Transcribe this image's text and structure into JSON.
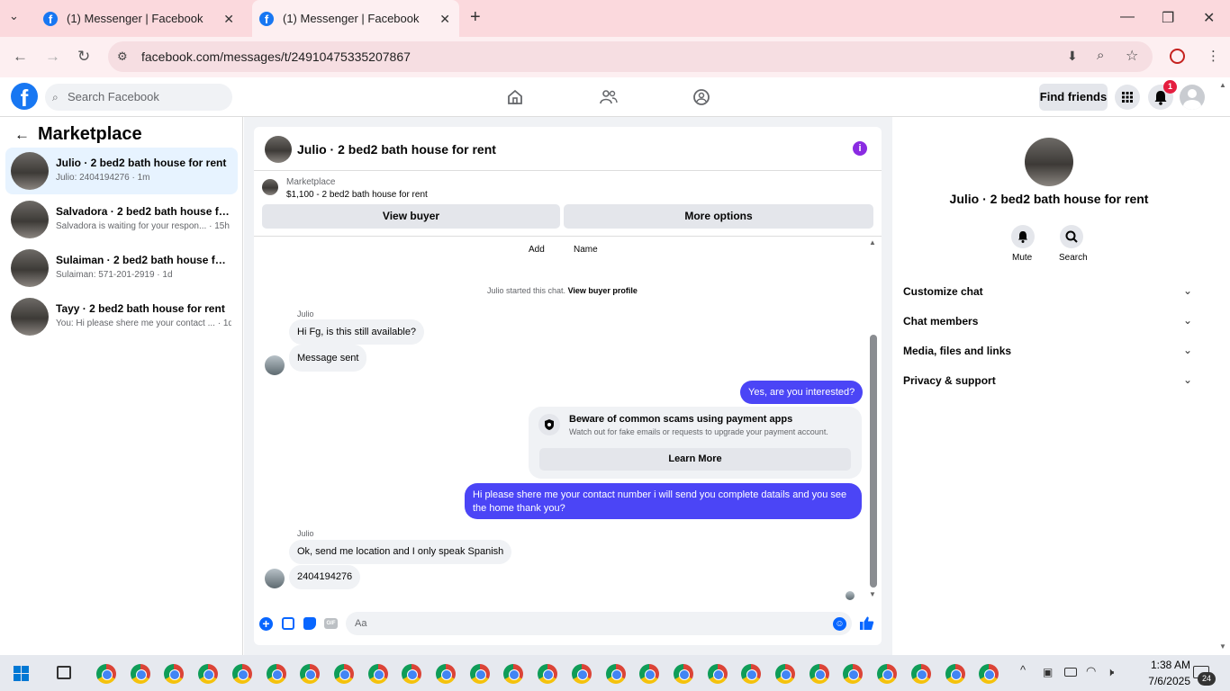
{
  "browser": {
    "tabs": [
      {
        "title": "(1) Messenger | Facebook"
      },
      {
        "title": "(1) Messenger | Facebook"
      }
    ],
    "url": "facebook.com/messages/t/24910475335207867"
  },
  "fb": {
    "search_placeholder": "Search Facebook",
    "find_friends": "Find friends",
    "notification_count": "1"
  },
  "sidebar": {
    "title": "Marketplace",
    "conversations": [
      {
        "name": "Julio · 2 bed2 bath house for rent",
        "preview": "Julio: 2404194276 · 1m"
      },
      {
        "name": "Salvadora · 2 bed2 bath house for ...",
        "preview": "Salvadora is waiting for your respon... · 15h"
      },
      {
        "name": "Sulaiman · 2 bed2 bath house for r...",
        "preview": "Sulaiman: 571-201-2919 · 1d"
      },
      {
        "name": "Tayy · 2 bed2 bath house for rent",
        "preview": "You: Hi please shere me your contact ... · 1d"
      }
    ]
  },
  "chat": {
    "title": "Julio · 2 bed2 bath house for rent",
    "listing_source": "Marketplace",
    "listing": "$1,100 - 2 bed2 bath house for rent",
    "view_buyer": "View buyer",
    "more_options": "More options",
    "add_label": "Add",
    "name_label": "Name",
    "started_text": "Julio started this chat.",
    "view_buyer_profile": "View buyer profile",
    "messages": [
      {
        "sender": "Julio",
        "text": "Hi Fg, is this still available?"
      },
      {
        "text": "Message sent"
      },
      {
        "text": "Yes, are you interested?"
      },
      {
        "text": "Hi please shere me your contact number i will send you complete datails and you see",
        "text2": "the home thank you?"
      },
      {
        "sender": "Julio",
        "text": "Ok, send me location and I only speak Spanish"
      },
      {
        "text": "2404194276"
      }
    ],
    "scam_title": "Beware of common scams using payment apps",
    "scam_text": "Watch out for fake emails or requests to upgrade your payment account.",
    "learn_more": "Learn More",
    "composer_placeholder": "Aa"
  },
  "details": {
    "title": "Julio · 2 bed2 bath house for rent",
    "mute": "Mute",
    "search": "Search",
    "sections": [
      "Customize chat",
      "Chat members",
      "Media, files and links",
      "Privacy & support"
    ]
  },
  "taskbar": {
    "time": "1:38 AM",
    "date": "7/6/2025",
    "notif": "24"
  }
}
